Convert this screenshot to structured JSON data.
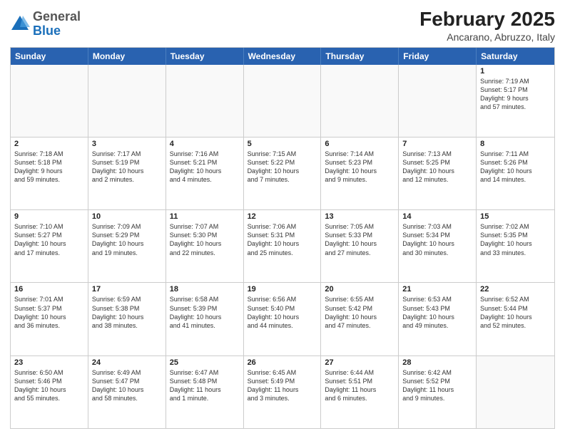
{
  "header": {
    "logo_general": "General",
    "logo_blue": "Blue",
    "month_year": "February 2025",
    "location": "Ancarano, Abruzzo, Italy"
  },
  "day_headers": [
    "Sunday",
    "Monday",
    "Tuesday",
    "Wednesday",
    "Thursday",
    "Friday",
    "Saturday"
  ],
  "weeks": [
    {
      "days": [
        {
          "num": "",
          "info": ""
        },
        {
          "num": "",
          "info": ""
        },
        {
          "num": "",
          "info": ""
        },
        {
          "num": "",
          "info": ""
        },
        {
          "num": "",
          "info": ""
        },
        {
          "num": "",
          "info": ""
        },
        {
          "num": "1",
          "info": "Sunrise: 7:19 AM\nSunset: 5:17 PM\nDaylight: 9 hours\nand 57 minutes."
        }
      ]
    },
    {
      "days": [
        {
          "num": "2",
          "info": "Sunrise: 7:18 AM\nSunset: 5:18 PM\nDaylight: 9 hours\nand 59 minutes."
        },
        {
          "num": "3",
          "info": "Sunrise: 7:17 AM\nSunset: 5:19 PM\nDaylight: 10 hours\nand 2 minutes."
        },
        {
          "num": "4",
          "info": "Sunrise: 7:16 AM\nSunset: 5:21 PM\nDaylight: 10 hours\nand 4 minutes."
        },
        {
          "num": "5",
          "info": "Sunrise: 7:15 AM\nSunset: 5:22 PM\nDaylight: 10 hours\nand 7 minutes."
        },
        {
          "num": "6",
          "info": "Sunrise: 7:14 AM\nSunset: 5:23 PM\nDaylight: 10 hours\nand 9 minutes."
        },
        {
          "num": "7",
          "info": "Sunrise: 7:13 AM\nSunset: 5:25 PM\nDaylight: 10 hours\nand 12 minutes."
        },
        {
          "num": "8",
          "info": "Sunrise: 7:11 AM\nSunset: 5:26 PM\nDaylight: 10 hours\nand 14 minutes."
        }
      ]
    },
    {
      "days": [
        {
          "num": "9",
          "info": "Sunrise: 7:10 AM\nSunset: 5:27 PM\nDaylight: 10 hours\nand 17 minutes."
        },
        {
          "num": "10",
          "info": "Sunrise: 7:09 AM\nSunset: 5:29 PM\nDaylight: 10 hours\nand 19 minutes."
        },
        {
          "num": "11",
          "info": "Sunrise: 7:07 AM\nSunset: 5:30 PM\nDaylight: 10 hours\nand 22 minutes."
        },
        {
          "num": "12",
          "info": "Sunrise: 7:06 AM\nSunset: 5:31 PM\nDaylight: 10 hours\nand 25 minutes."
        },
        {
          "num": "13",
          "info": "Sunrise: 7:05 AM\nSunset: 5:33 PM\nDaylight: 10 hours\nand 27 minutes."
        },
        {
          "num": "14",
          "info": "Sunrise: 7:03 AM\nSunset: 5:34 PM\nDaylight: 10 hours\nand 30 minutes."
        },
        {
          "num": "15",
          "info": "Sunrise: 7:02 AM\nSunset: 5:35 PM\nDaylight: 10 hours\nand 33 minutes."
        }
      ]
    },
    {
      "days": [
        {
          "num": "16",
          "info": "Sunrise: 7:01 AM\nSunset: 5:37 PM\nDaylight: 10 hours\nand 36 minutes."
        },
        {
          "num": "17",
          "info": "Sunrise: 6:59 AM\nSunset: 5:38 PM\nDaylight: 10 hours\nand 38 minutes."
        },
        {
          "num": "18",
          "info": "Sunrise: 6:58 AM\nSunset: 5:39 PM\nDaylight: 10 hours\nand 41 minutes."
        },
        {
          "num": "19",
          "info": "Sunrise: 6:56 AM\nSunset: 5:40 PM\nDaylight: 10 hours\nand 44 minutes."
        },
        {
          "num": "20",
          "info": "Sunrise: 6:55 AM\nSunset: 5:42 PM\nDaylight: 10 hours\nand 47 minutes."
        },
        {
          "num": "21",
          "info": "Sunrise: 6:53 AM\nSunset: 5:43 PM\nDaylight: 10 hours\nand 49 minutes."
        },
        {
          "num": "22",
          "info": "Sunrise: 6:52 AM\nSunset: 5:44 PM\nDaylight: 10 hours\nand 52 minutes."
        }
      ]
    },
    {
      "days": [
        {
          "num": "23",
          "info": "Sunrise: 6:50 AM\nSunset: 5:46 PM\nDaylight: 10 hours\nand 55 minutes."
        },
        {
          "num": "24",
          "info": "Sunrise: 6:49 AM\nSunset: 5:47 PM\nDaylight: 10 hours\nand 58 minutes."
        },
        {
          "num": "25",
          "info": "Sunrise: 6:47 AM\nSunset: 5:48 PM\nDaylight: 11 hours\nand 1 minute."
        },
        {
          "num": "26",
          "info": "Sunrise: 6:45 AM\nSunset: 5:49 PM\nDaylight: 11 hours\nand 3 minutes."
        },
        {
          "num": "27",
          "info": "Sunrise: 6:44 AM\nSunset: 5:51 PM\nDaylight: 11 hours\nand 6 minutes."
        },
        {
          "num": "28",
          "info": "Sunrise: 6:42 AM\nSunset: 5:52 PM\nDaylight: 11 hours\nand 9 minutes."
        },
        {
          "num": "",
          "info": ""
        }
      ]
    }
  ]
}
